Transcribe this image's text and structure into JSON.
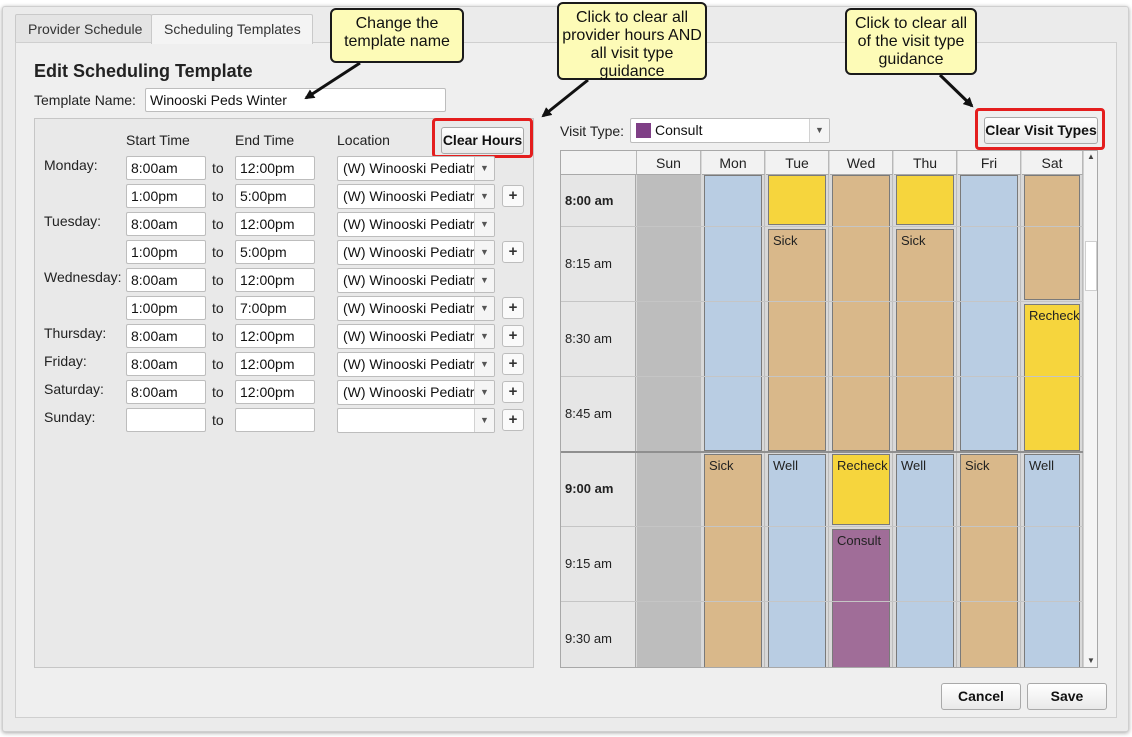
{
  "tabs": [
    {
      "label": "Provider Schedule"
    },
    {
      "label": "Scheduling Templates"
    }
  ],
  "editor": {
    "title": "Edit Scheduling Template",
    "template_name_label": "Template Name:",
    "template_name_value": "Winooski Peds Winter"
  },
  "hours": {
    "col_start": "Start Time",
    "col_end": "End Time",
    "col_location": "Location",
    "clear_hours_label": "Clear Hours",
    "to_label": "to",
    "plus_label": "+",
    "days": [
      "Monday:",
      "Tuesday:",
      "Wednesday:",
      "Thursday:",
      "Friday:",
      "Saturday:",
      "Sunday:"
    ],
    "rows": [
      {
        "start": "8:00am",
        "end": "12:00pm",
        "location": "(W) Winooski Pediatrics"
      },
      {
        "start": "1:00pm",
        "end": "5:00pm",
        "location": "(W) Winooski Pediatrics"
      },
      {
        "start": "8:00am",
        "end": "12:00pm",
        "location": "(W) Winooski Pediatrics"
      },
      {
        "start": "1:00pm",
        "end": "5:00pm",
        "location": "(W) Winooski Pediatrics"
      },
      {
        "start": "8:00am",
        "end": "12:00pm",
        "location": "(W) Winooski Pediatrics"
      },
      {
        "start": "1:00pm",
        "end": "7:00pm",
        "location": "(W) Winooski Pediatrics"
      },
      {
        "start": "8:00am",
        "end": "12:00pm",
        "location": "(W) Winooski Pediatrics"
      },
      {
        "start": "8:00am",
        "end": "12:00pm",
        "location": "(W) Winooski Pediatrics"
      },
      {
        "start": "8:00am",
        "end": "12:00pm",
        "location": "(W) Winooski Pediatrics"
      },
      {
        "start": "",
        "end": "",
        "location": ""
      }
    ]
  },
  "visit_type": {
    "label": "Visit Type:",
    "selected": "Consult",
    "selected_color": "#7f3f86",
    "clear_visit_types_label": "Clear Visit Types"
  },
  "calendar": {
    "days": [
      "Sun",
      "Mon",
      "Tue",
      "Wed",
      "Thu",
      "Fri",
      "Sat"
    ],
    "times": [
      "8:00 am",
      "8:15 am",
      "8:30 am",
      "8:45 am",
      "9:00 am",
      "9:15 am",
      "9:30 am"
    ],
    "colors": {
      "Well": "#b9cde3",
      "Sick": "#d9b88a",
      "Recheck": "#f6d53d",
      "Consult": "#a06d98",
      "Closed": "#bdbdbd"
    },
    "block_labels": {
      "tue_sick": "Sick",
      "thu_sick": "Sick",
      "sat_recheck": "Recheck",
      "mon_sick": "Sick",
      "tue_well": "Well",
      "wed_recheck": "Recheck",
      "thu_well": "Well",
      "fri_sick": "Sick",
      "sat_well": "Well",
      "wed_consult": "Consult"
    }
  },
  "footer": {
    "cancel_label": "Cancel",
    "save_label": "Save"
  },
  "callouts": {
    "template_name": "Change the template name",
    "clear_hours": "Click to clear all provider hours AND all visit type guidance",
    "clear_visit_types": "Click to clear all of the visit type guidance"
  }
}
